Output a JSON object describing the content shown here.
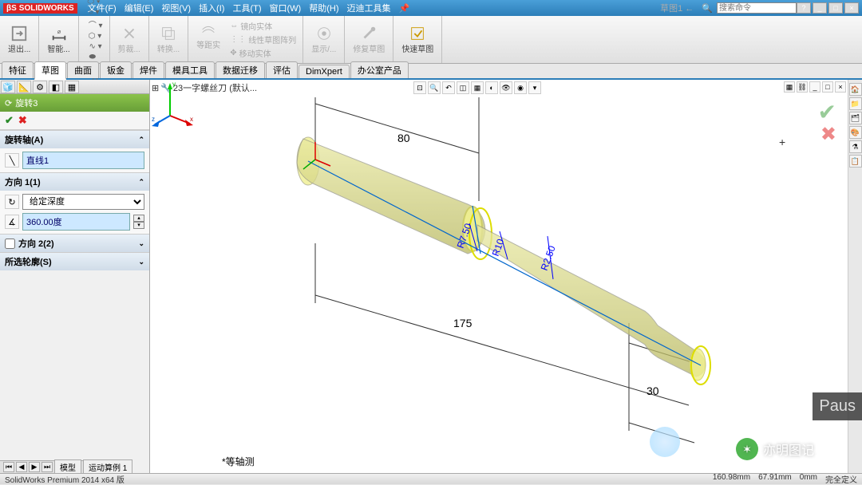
{
  "title": {
    "app": "SOLIDWORKS",
    "menus": [
      "文件(F)",
      "编辑(E)",
      "视图(V)",
      "插入(I)",
      "工具(T)",
      "窗口(W)",
      "帮助(H)",
      "迈迪工具集"
    ],
    "doc": "草图1 ←",
    "search_placeholder": "搜索命令"
  },
  "ribbon": {
    "exit": "退出...",
    "smartdim": "智能...",
    "trim": "剪裁...",
    "convert": "转换...",
    "offset": "等距实",
    "mirror": "镜向实体",
    "linear": "线性草图阵列",
    "move": "移动实体",
    "display": "显示/...",
    "repair": "修复草图",
    "quick": "快速草图"
  },
  "tabs": [
    "特征",
    "草图",
    "曲面",
    "钣金",
    "焊件",
    "模具工具",
    "数据迁移",
    "评估",
    "DimXpert",
    "办公室产品"
  ],
  "active_tab": 1,
  "tree": {
    "root": "23一字螺丝刀  (默认..."
  },
  "pm": {
    "title": "旋转3",
    "sec_axis": "旋转轴(A)",
    "axis_sel": "直线1",
    "sec_dir1": "方向 1(1)",
    "dir1_type": "给定深度",
    "dir1_angle": "360.00度",
    "sec_dir2": "方向 2(2)",
    "sec_contours": "所选轮廓(S)"
  },
  "dimensions": {
    "d80": "80",
    "d175": "175",
    "d30": "30",
    "r750": "R7.50",
    "r10": "R10",
    "r250": "R2.50"
  },
  "viewlabel": "*等轴测",
  "bottomtabs": [
    "模型",
    "运动算例 1"
  ],
  "status": {
    "left": "SolidWorks Premium 2014 x64 版",
    "coord1": "160.98mm",
    "coord2": "67.91mm",
    "coord3": "0mm",
    "state": "完全定义"
  },
  "watermark": "亦明图记",
  "paus": "Paus"
}
